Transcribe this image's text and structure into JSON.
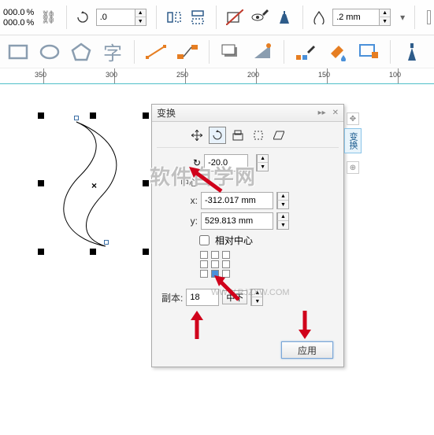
{
  "topbar": {
    "pct_top": "000.0",
    "pct_bot": "000.0",
    "rotation": ".0",
    "stroke": ".2 mm"
  },
  "ruler": {
    "ticks": [
      350,
      300,
      250,
      200,
      150,
      100
    ]
  },
  "dock": {
    "title": "变换",
    "rotation_value": "-20.0",
    "center_label": "中心",
    "x_label": "x:",
    "x_value": "-312.017 mm",
    "y_label": "y:",
    "y_value": "529.813 mm",
    "relative_center_label": "相对中心",
    "copies_label": "副本:",
    "copies_value": "18",
    "mid_btn": "中下",
    "apply": "应用",
    "sidetab": "变换"
  },
  "watermark": "软件自学网",
  "watermark_url": "WWW.RJZXW.COM"
}
